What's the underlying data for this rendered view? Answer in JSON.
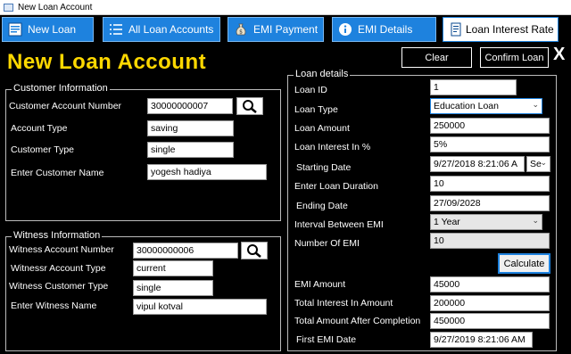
{
  "window": {
    "title": "New Loan Account"
  },
  "tabs": [
    {
      "label": "New Loan"
    },
    {
      "label": "All Loan Accounts"
    },
    {
      "label": "EMI Payment"
    },
    {
      "label": "EMI  Details"
    },
    {
      "label": "Loan Interest Rate"
    }
  ],
  "page": {
    "title": "New Loan Account"
  },
  "toolbar": {
    "clear_label": "Clear",
    "confirm_label": "Confirm Loan",
    "close_label": "X"
  },
  "customer": {
    "group_title": "Customer Information",
    "account_number_label": "Customer Account Number",
    "account_number": "30000000007",
    "account_type_label": "Account Type",
    "account_type": "saving",
    "customer_type_label": "Customer Type",
    "customer_type": "single",
    "name_label": "Enter Customer Name",
    "name": "yogesh hadiya"
  },
  "witness": {
    "group_title": "Witness Information",
    "account_number_label": "Witness Account Number",
    "account_number": "30000000006",
    "account_type_label": "Witnessr Account Type",
    "account_type": "current",
    "customer_type_label": "Witness Customer Type",
    "customer_type": "single",
    "name_label": "Enter Witness Name",
    "name": "vipul kotval"
  },
  "loan": {
    "group_title": "Loan details",
    "id_label": "Loan ID",
    "id": "1",
    "type_label": "Loan Type",
    "type": "Education Loan",
    "amount_label": "Loan Amount",
    "amount": "250000",
    "interest_label": "Loan Interest In %",
    "interest": "5%",
    "start_label": "Starting Date",
    "start": "9/27/2018 8:21:06 A",
    "start_day": "Se",
    "duration_label": "Enter Loan Duration",
    "duration": "10",
    "end_label": "Ending Date",
    "end": "27/09/2028",
    "interval_label": "Interval Between EMI",
    "interval": "1 Year",
    "num_emi_label": "Number Of EMI",
    "num_emi": "10",
    "calculate_label": "Calculate",
    "emi_amount_label": "EMI Amount",
    "emi_amount": "45000",
    "total_interest_label": "Total Interest In Amount",
    "total_interest": "200000",
    "total_amount_label": "Total Amount After Completion",
    "total_amount": "450000",
    "first_emi_label": "First EMI Date",
    "first_emi": "9/27/2019 8:21:06 AM"
  },
  "colors": {
    "accent": "#1e82de",
    "title": "#ffd800",
    "background": "#000000"
  }
}
